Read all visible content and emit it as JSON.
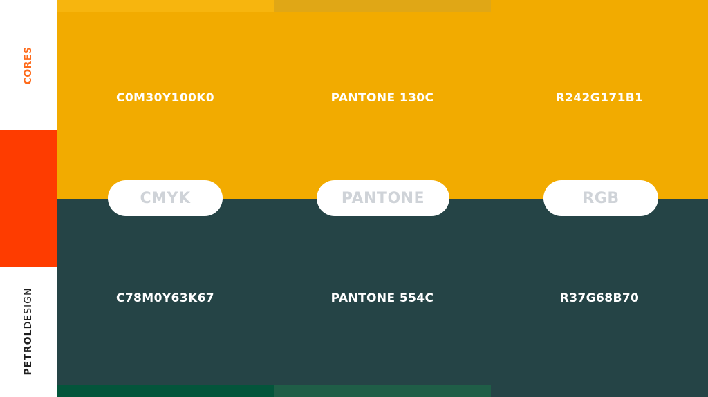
{
  "sidebar": {
    "section_label": "CORES",
    "brand_bold": "PETROL",
    "brand_light": "DESIGN",
    "logo_icon": "petrol-logo-icon"
  },
  "colors": {
    "orange": "#fe3c00",
    "label_orange": "#fe6a1a",
    "yellow": "#f2ab00",
    "dark_teal": "#254446",
    "pill_text": "#cfd3d8"
  },
  "primary_color": {
    "cmyk": "C0M30Y100K0",
    "pantone": "PANTONE 130C",
    "rgb": "R242G171B1"
  },
  "secondary_color": {
    "cmyk": "C78M0Y63K67",
    "pantone": "PANTONE 554C",
    "rgb": "R37G68B70"
  },
  "labels": {
    "cmyk": "CMYK",
    "pantone": "PANTONE",
    "rgb": "RGB"
  }
}
